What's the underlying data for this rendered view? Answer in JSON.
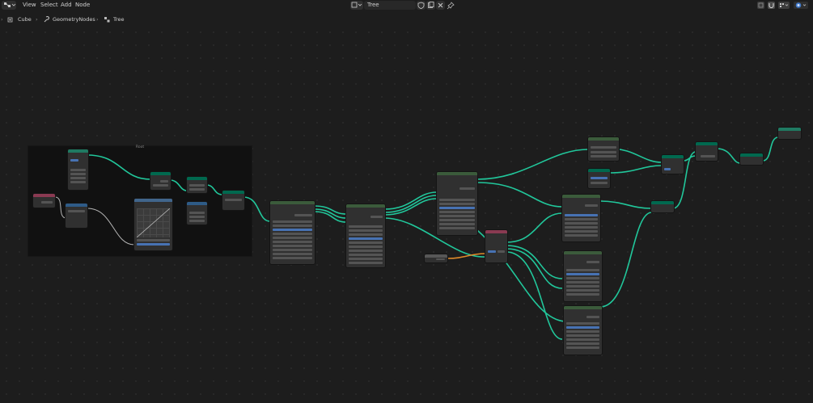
{
  "menu": {
    "view": "View",
    "select": "Select",
    "add": "Add",
    "node": "Node"
  },
  "header": {
    "tree_name": "Tree"
  },
  "breadcrumb": {
    "object": "Cube",
    "modifier": "GeometryNodes",
    "node_tree": "Tree"
  },
  "frame": {
    "label": "Root"
  },
  "colors": {
    "wire": "#21c79b",
    "wire_orange": "#e08a2a",
    "header_geometry": "#00694f",
    "header_input": "#8a3a52",
    "header_vector": "#2e5b87",
    "header_float_curve": "#41658b",
    "header_utility": "#3b5b3b"
  }
}
